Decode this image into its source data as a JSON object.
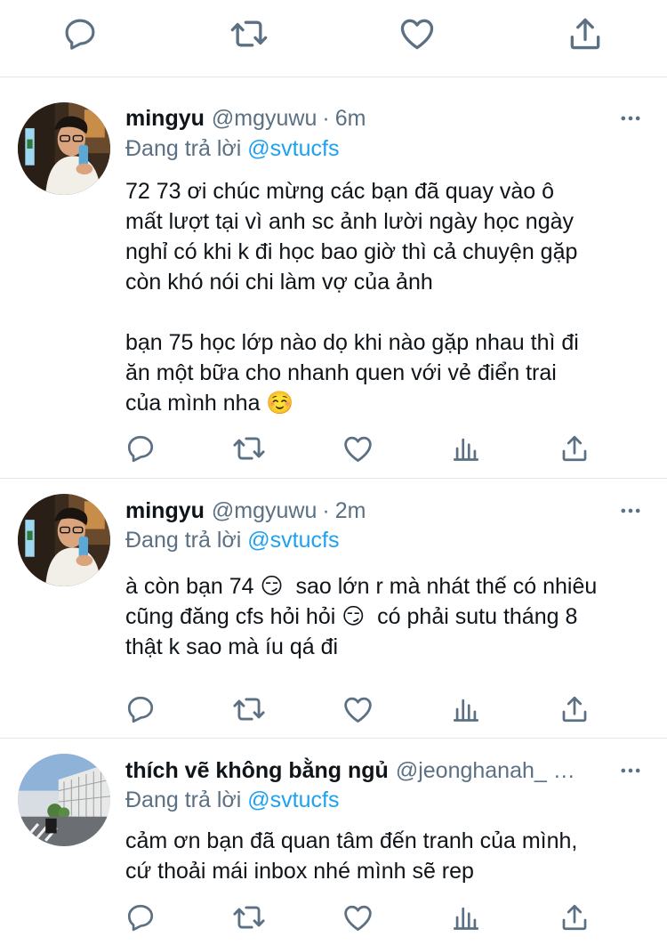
{
  "top_actions": [
    "reply",
    "retweet",
    "like",
    "share"
  ],
  "colors": {
    "icon_gray": "#5b7083",
    "link_blue": "#1da1f2",
    "text": "#0f1419",
    "divider": "#e1e8ed"
  },
  "tweets": [
    {
      "name": "mingyu",
      "handle": "@mgyuwu",
      "dot": "·",
      "time": "6m",
      "reply_prefix": "Đang trả lời",
      "reply_to": "@svtucfs",
      "text": "72 73 ơi chúc mừng các bạn đã quay vào ô\nmất lượt tại vì anh sc ảnh lười ngày học ngày\nnghỉ có khi k đi học bao giờ thì cả chuyện gặp\ncòn khó nói chi làm vợ của ảnh\n\nbạn 75 học lớp nào dọ khi nào gặp nhau thì đi\năn một bữa cho nhanh quen với vẻ điển trai\ncủa mình nha ☺️",
      "avatar": "avatar-photo-man-glasses"
    },
    {
      "name": "mingyu",
      "handle": "@mgyuwu",
      "dot": "·",
      "time": "2m",
      "reply_prefix": "Đang trả lời",
      "reply_to": "@svtucfs",
      "text": "à còn bạn 74 😏  sao lớn r mà nhát thế có nhiêu\ncũng đăng cfs hỏi hỏi 😏  có phải sutu tháng 8\nthật k sao mà íu qá đi",
      "avatar": "avatar-photo-man-glasses"
    },
    {
      "name": "thích vẽ không bằng ngủ",
      "handle": "@jeonghanah_ …",
      "dot": "",
      "time": "",
      "reply_prefix": "Đang trả lời",
      "reply_to": "@svtucfs",
      "text": "cảm ơn bạn đã quan tâm đến tranh của mình,\ncứ thoải mái inbox nhé mình sẽ rep",
      "avatar": "avatar-photo-street"
    }
  ]
}
